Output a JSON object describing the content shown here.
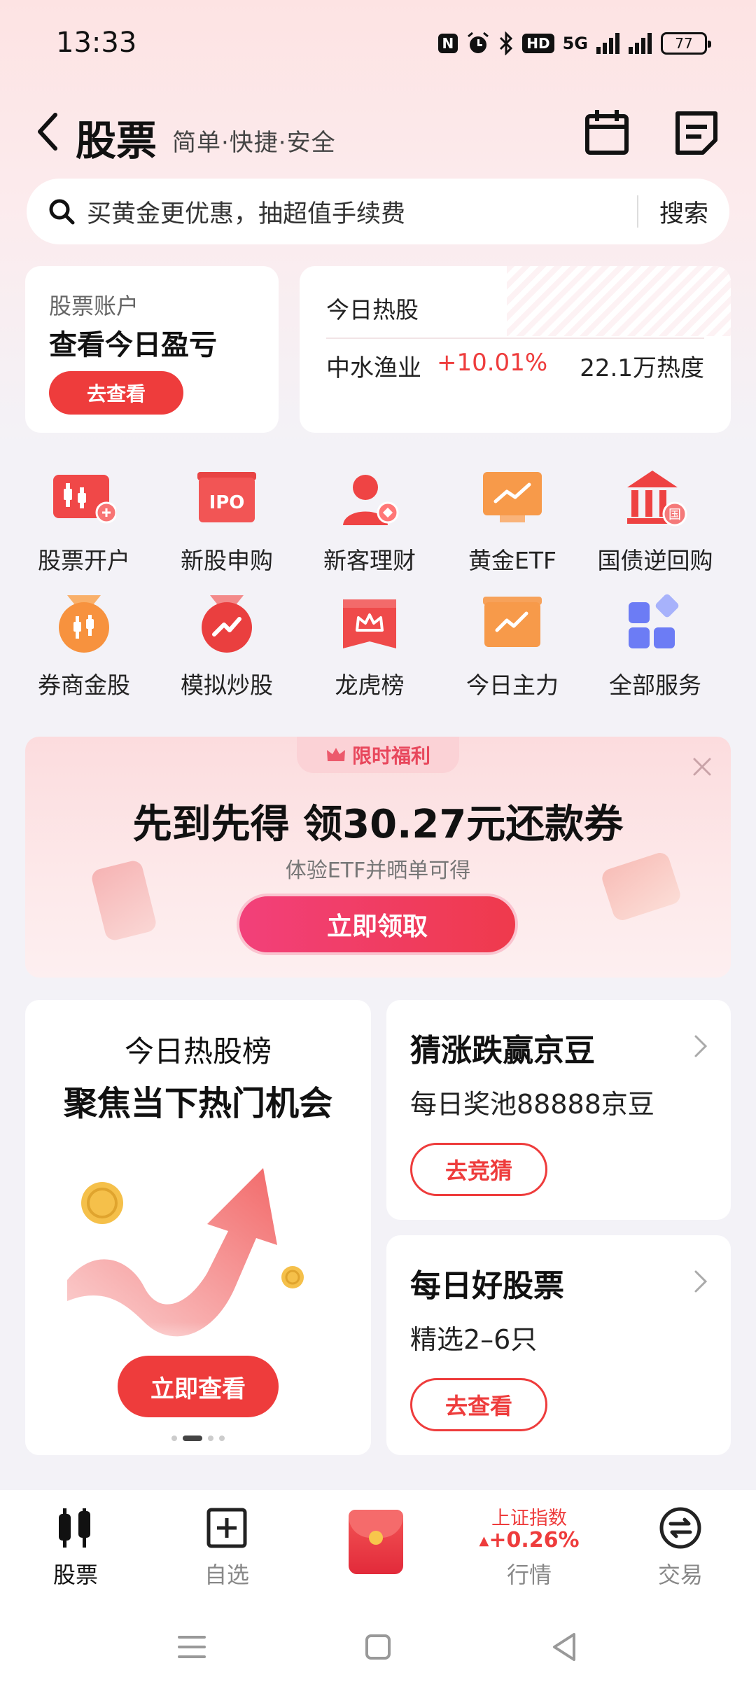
{
  "status_bar": {
    "time": "13:33",
    "network": "5G",
    "battery": "77"
  },
  "header": {
    "title": "股票",
    "subtitle": "简单·快捷·安全"
  },
  "search": {
    "placeholder": "买黄金更优惠，抽超值手续费",
    "button": "搜索"
  },
  "account": {
    "label": "股票账户",
    "title": "查看今日盈亏",
    "button": "去查看"
  },
  "hot": {
    "title": "今日热股",
    "stock_name": "中水渔业",
    "change": "+10.01%",
    "heat": "22.1万热度"
  },
  "services": [
    {
      "label": "股票开户",
      "icon": "account-open-icon"
    },
    {
      "label": "新股申购",
      "icon": "ipo-icon",
      "icon_text": "IPO"
    },
    {
      "label": "新客理财",
      "icon": "new-user-icon"
    },
    {
      "label": "黄金ETF",
      "icon": "gold-etf-icon"
    },
    {
      "label": "国债逆回购",
      "icon": "bank-icon",
      "icon_text": "国"
    },
    {
      "label": "券商金股",
      "icon": "gold-medal-icon"
    },
    {
      "label": "模拟炒股",
      "icon": "simulation-icon"
    },
    {
      "label": "龙虎榜",
      "icon": "crown-icon"
    },
    {
      "label": "今日主力",
      "icon": "main-force-icon"
    },
    {
      "label": "全部服务",
      "icon": "all-services-icon"
    }
  ],
  "promo": {
    "tag": "限时福利",
    "title": "先到先得 领30.27元还款券",
    "subtitle": "体验ETF并晒单可得",
    "button": "立即领取"
  },
  "rank_card": {
    "title": "今日热股榜",
    "subtitle": "聚焦当下热门机会",
    "button": "立即查看",
    "page_count": 4,
    "active_page": 1
  },
  "guess_card": {
    "title": "猜涨跌赢京豆",
    "subtitle": "每日奖池88888京豆",
    "button": "去竞猜"
  },
  "daily_card": {
    "title": "每日好股票",
    "subtitle": "精选2–6只",
    "button": "去查看"
  },
  "bottom_nav": {
    "stocks": "股票",
    "watchlist": "自选",
    "market_index": "上证指数",
    "market_change": "+0.26%",
    "market": "行情",
    "trade": "交易"
  },
  "colors": {
    "accent": "#ee3c3c",
    "background": "#f3f2f7"
  }
}
